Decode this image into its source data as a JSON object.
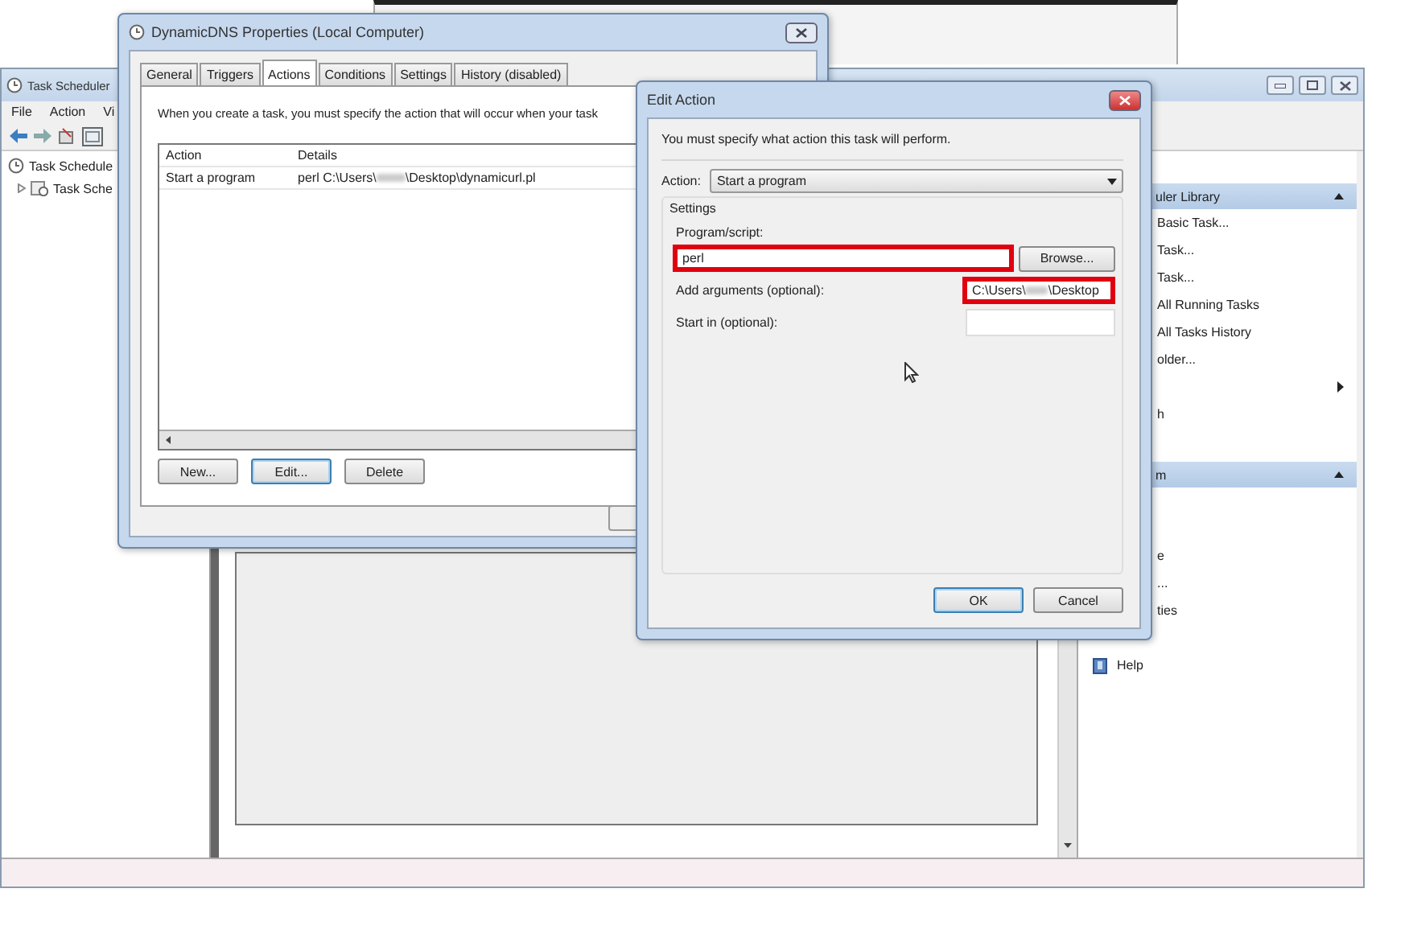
{
  "main_window": {
    "title": "Task Scheduler",
    "menu": [
      "File",
      "Action",
      "Vi"
    ],
    "tree": [
      {
        "label": "Task Schedule",
        "children": [
          {
            "label": "Task Sche",
            "expanded": false
          }
        ]
      }
    ],
    "actions_pane": [
      {
        "header": "uler Library",
        "items": [
          {
            "kind": "text",
            "label": "Basic Task..."
          },
          {
            "kind": "text",
            "label": "Task..."
          },
          {
            "kind": "text",
            "label": "Task..."
          },
          {
            "kind": "text",
            "label": "All Running Tasks"
          },
          {
            "kind": "text",
            "label": "All Tasks History"
          },
          {
            "kind": "text",
            "label": "older..."
          },
          {
            "kind": "submenu"
          },
          {
            "kind": "text",
            "label": "h"
          }
        ]
      },
      {
        "header": "m",
        "items": [
          {
            "kind": "text",
            "label": "e"
          },
          {
            "kind": "text",
            "label": "..."
          },
          {
            "kind": "text",
            "label": "ties"
          },
          {
            "kind": "help",
            "label": "Help"
          }
        ]
      }
    ]
  },
  "properties_dialog": {
    "title": "DynamicDNS Properties (Local Computer)",
    "tabs": [
      {
        "label": "General",
        "selected": false
      },
      {
        "label": "Triggers",
        "selected": false
      },
      {
        "label": "Actions",
        "selected": true
      },
      {
        "label": "Conditions",
        "selected": false
      },
      {
        "label": "Settings",
        "selected": false
      },
      {
        "label": "History (disabled)",
        "selected": false
      }
    ],
    "description": "When you create a task, you must specify the action that will occur when your task",
    "columns": [
      "Action",
      "Details"
    ],
    "rows": [
      {
        "action": "Start a program",
        "details_before": "perl C:\\Users\\",
        "details_after": "\\Desktop\\dynamicurl.pl"
      }
    ],
    "buttons": [
      {
        "label": "New...",
        "focused": false
      },
      {
        "label": "Edit...",
        "focused": true
      },
      {
        "label": "Delete",
        "focused": false
      }
    ]
  },
  "edit_action_dialog": {
    "title": "Edit Action",
    "instruction": "You must specify what action this task will perform.",
    "action_label": "Action:",
    "action_value": "Start a program",
    "settings_label": "Settings",
    "program_label": "Program/script:",
    "program_value": "perl",
    "program_highlighted": true,
    "browse": "Browse...",
    "arguments_label": "Add arguments (optional):",
    "arguments_before": "C:\\Users\\",
    "arguments_after": "\\Desktop",
    "arguments_highlighted": true,
    "start_in_label": "Start in (optional):",
    "buttons": [
      {
        "label": "OK",
        "focused": true
      },
      {
        "label": "Cancel",
        "focused": false
      }
    ]
  }
}
